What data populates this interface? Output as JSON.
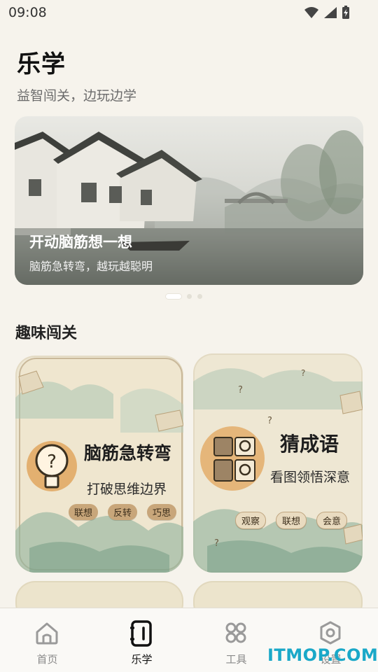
{
  "status": {
    "time": "09:08"
  },
  "header": {
    "title": "乐学",
    "subtitle": "益智闯关，边玩边学"
  },
  "banner": {
    "title": "开动脑筋想一想",
    "subtitle": "脑筋急转弯，越玩越聪明",
    "active_index": 0,
    "total": 3
  },
  "section": {
    "title": "趣味闯关"
  },
  "cards": [
    {
      "title": "脑筋急转弯",
      "subtitle": "打破思维边界",
      "tags": [
        "联想",
        "反转",
        "巧思"
      ]
    },
    {
      "title": "猜成语",
      "subtitle": "看图领悟深意",
      "tags": [
        "观察",
        "联想",
        "会意"
      ]
    }
  ],
  "tabs": [
    {
      "label": "首页",
      "icon": "home-icon"
    },
    {
      "label": "乐学",
      "icon": "notebook-icon",
      "active": true
    },
    {
      "label": "工具",
      "icon": "grid-icon"
    },
    {
      "label": "设置",
      "icon": "settings-icon"
    }
  ],
  "watermark": "ITMOP.COM",
  "colors": {
    "background": "#f6f3ec",
    "tag_brown": "#c8a67a",
    "watermark": "#1aa8c8"
  }
}
